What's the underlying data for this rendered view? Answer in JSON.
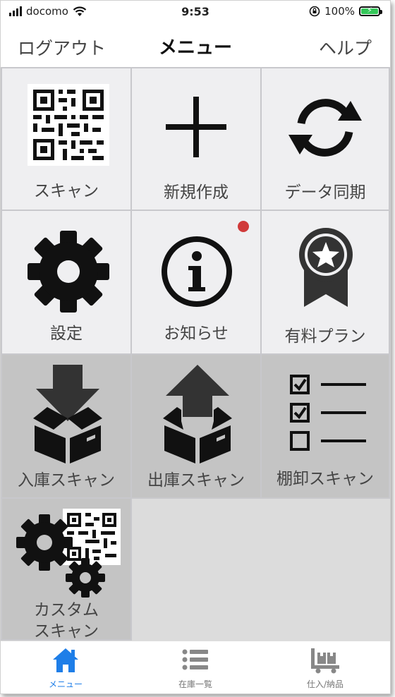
{
  "status_bar": {
    "carrier": "docomo",
    "time": "9:53",
    "battery": "100%",
    "battery_level": 1.0,
    "battery_color": "#34c759"
  },
  "nav": {
    "left": "ログアウト",
    "title": "メニュー",
    "right": "ヘルプ"
  },
  "menu": {
    "scan": {
      "label": "スキャン",
      "icon": "qr-code-icon"
    },
    "new": {
      "label": "新規作成",
      "icon": "plus-icon"
    },
    "sync": {
      "label": "データ同期",
      "icon": "sync-icon"
    },
    "settings": {
      "label": "設定",
      "icon": "gear-icon"
    },
    "news": {
      "label": "お知らせ",
      "icon": "info-icon",
      "has_badge": true
    },
    "plan": {
      "label": "有料プラン",
      "icon": "award-ribbon-icon"
    },
    "inbound": {
      "label": "入庫スキャン",
      "icon": "box-arrow-in-icon"
    },
    "outbound": {
      "label": "出庫スキャン",
      "icon": "box-arrow-out-icon"
    },
    "inventory": {
      "label": "棚卸スキャン",
      "icon": "checklist-icon"
    },
    "custom": {
      "label_line1": "カスタム",
      "label_line2": "スキャン",
      "icon": "gears-qr-icon"
    }
  },
  "tabs": {
    "menu": {
      "label": "メニュー",
      "icon": "home-icon",
      "active": true
    },
    "stock": {
      "label": "在庫一覧",
      "icon": "list-icon",
      "active": false
    },
    "receive": {
      "label": "仕入/納品",
      "icon": "cart-boxes-icon",
      "active": false
    }
  },
  "colors": {
    "accent": "#1e7ee8",
    "badge": "#d03a3a",
    "tile_light": "#efeff1",
    "tile_dark": "#c4c4c4"
  }
}
